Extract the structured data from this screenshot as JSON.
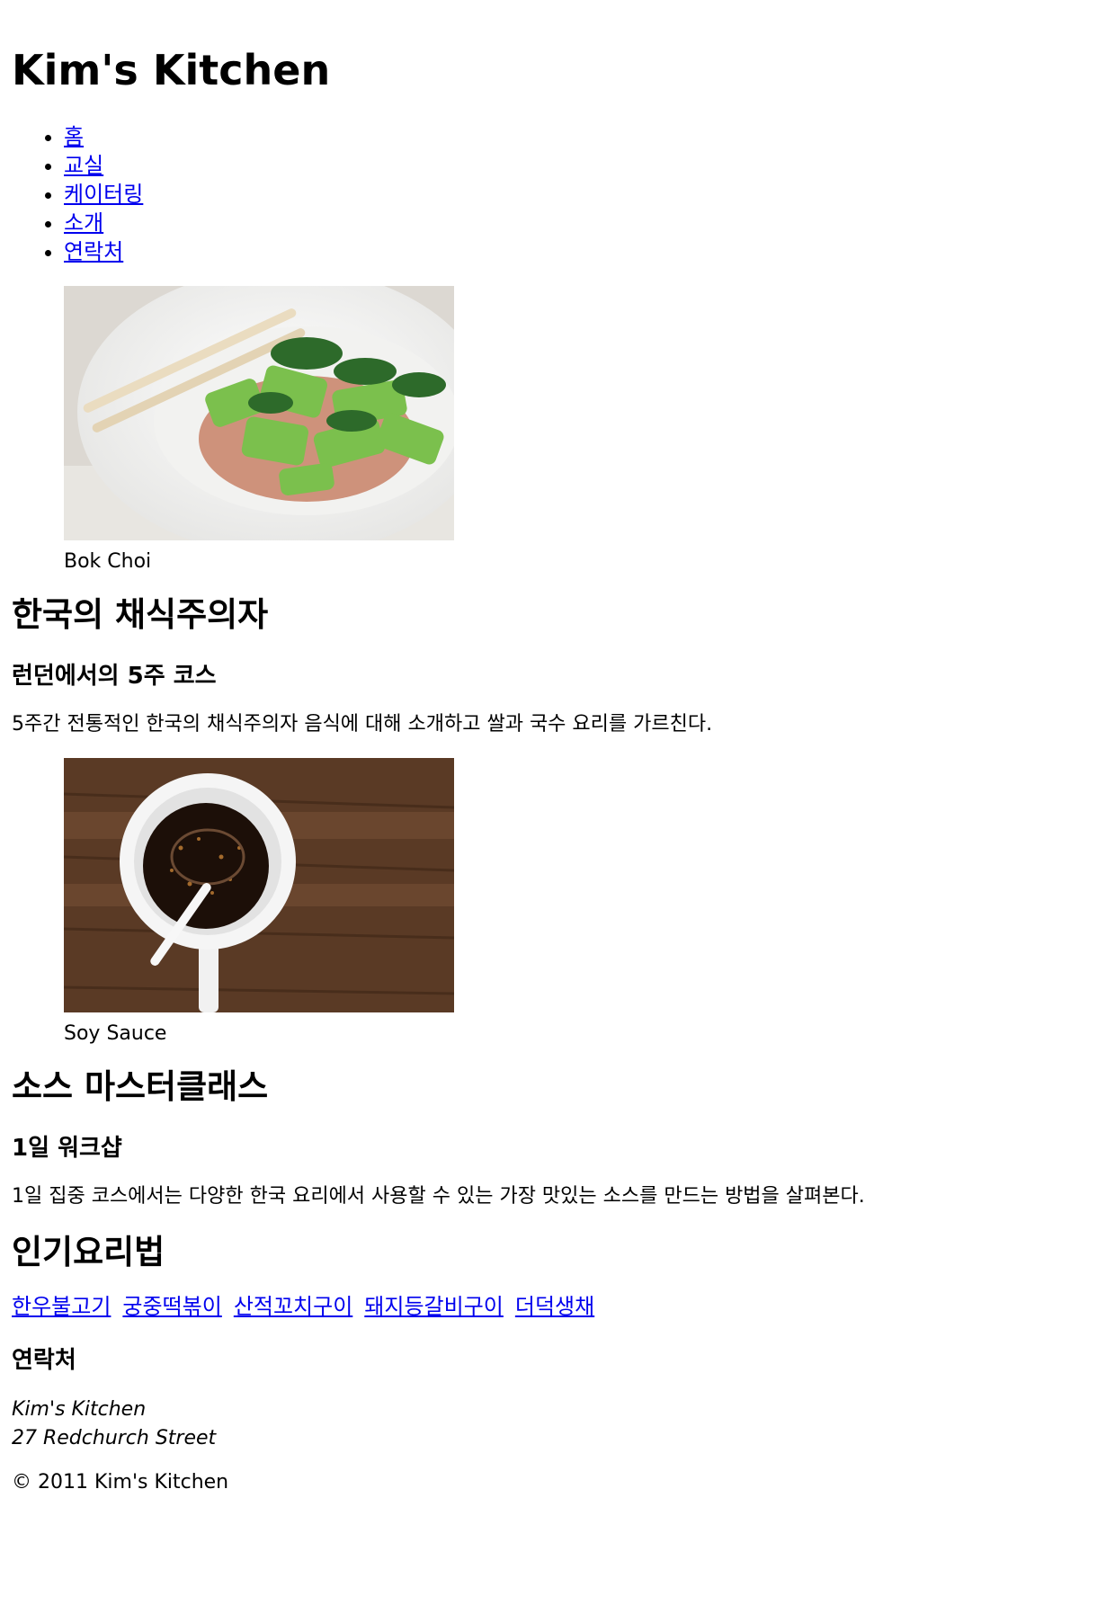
{
  "site": {
    "title": "Kim's Kitchen"
  },
  "nav": {
    "items": [
      {
        "label": "홈"
      },
      {
        "label": "교실"
      },
      {
        "label": "케이터링"
      },
      {
        "label": "소개"
      },
      {
        "label": "연락처"
      }
    ]
  },
  "course1": {
    "caption": "Bok Choi",
    "title": "한국의 채식주의자",
    "subtitle": "런던에서의 5주 코스",
    "description": "5주간 전통적인 한국의 채식주의자 음식에 대해 소개하고 쌀과 국수 요리를 가르친다."
  },
  "course2": {
    "caption": "Soy Sauce",
    "title": "소스 마스터클래스",
    "subtitle": "1일 워크샵",
    "description": "1일 집중 코스에서는 다양한 한국 요리에서 사용할 수 있는 가장 맛있는 소스를 만드는 방법을 살펴본다."
  },
  "recipes": {
    "title": "인기요리법",
    "links": [
      {
        "label": "한우불고기"
      },
      {
        "label": "궁중떡볶이"
      },
      {
        "label": "산적꼬치구이"
      },
      {
        "label": "돼지등갈비구이"
      },
      {
        "label": "더덕생채"
      }
    ]
  },
  "contact": {
    "title": "연락처",
    "name": "Kim's Kitchen",
    "address": "27 Redchurch Street"
  },
  "footer": {
    "copyright": "© 2011 Kim's Kitchen"
  }
}
